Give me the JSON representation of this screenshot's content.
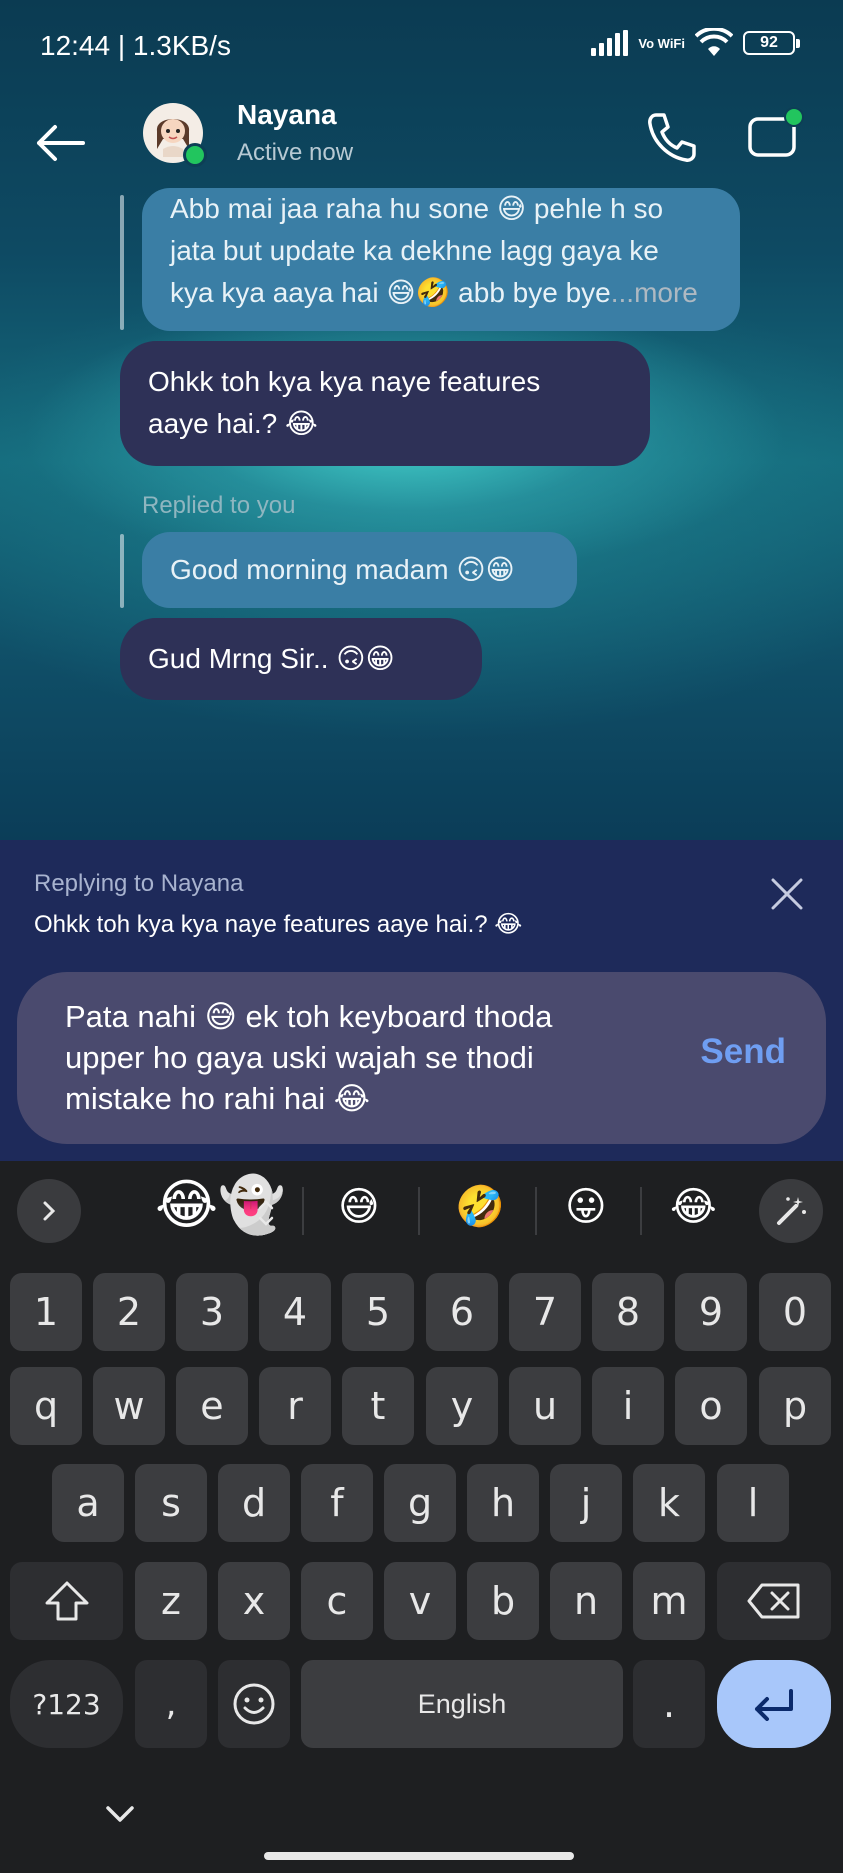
{
  "status_bar": {
    "time": "12:44 | 1.3KB/s",
    "network": "Vo WiFi",
    "battery": "92"
  },
  "header": {
    "name": "Nayana",
    "status": "Active now"
  },
  "messages": {
    "quoted_1": {
      "line1": "Abb mai jaa raha hu sone 😅 pehle h so",
      "line2": "jata but update ka dekhne lagg gaya ke",
      "line3": "kya kya aaya hai 😅🤣 abb bye bye",
      "more": "...more"
    },
    "sent_1": {
      "line1": "Ohkk toh kya kya naye features",
      "line2": "aaye hai.? 😂"
    },
    "replied_label": "Replied to you",
    "quoted_2": "Good morning  madam 🙃😁",
    "sent_2": "Gud Mrng Sir.. 🙃😁"
  },
  "reply_bar": {
    "title": "Replying to Nayana",
    "text": "Ohkk toh kya kya naye features aaye hai.? 😂"
  },
  "compose": {
    "line1": "Pata nahi 😅 ek toh keyboard thoda",
    "line2": "upper ho gaya uski wajah se thodi",
    "line3": "mistake ho rahi hai 😂",
    "send_label": "Send"
  },
  "keyboard": {
    "suggestions": [
      "😅",
      "🤣",
      "😛",
      "😂"
    ],
    "sticker": "😂👻",
    "row_numbers": [
      "1",
      "2",
      "3",
      "4",
      "5",
      "6",
      "7",
      "8",
      "9",
      "0"
    ],
    "row1": [
      "q",
      "w",
      "e",
      "r",
      "t",
      "y",
      "u",
      "i",
      "o",
      "p"
    ],
    "row2": [
      "a",
      "s",
      "d",
      "f",
      "g",
      "h",
      "j",
      "k",
      "l"
    ],
    "row3": [
      "z",
      "x",
      "c",
      "v",
      "b",
      "n",
      "m"
    ],
    "symbols_label": "?123",
    "comma": ",",
    "space_label": "English",
    "period": "."
  },
  "colors": {
    "accent_send": "#6f9ef2",
    "bubble_sent": "#2e3157",
    "bubble_quoted": "#3a7ea5",
    "online": "#22c55e",
    "enter_key": "#a8c7fa"
  }
}
